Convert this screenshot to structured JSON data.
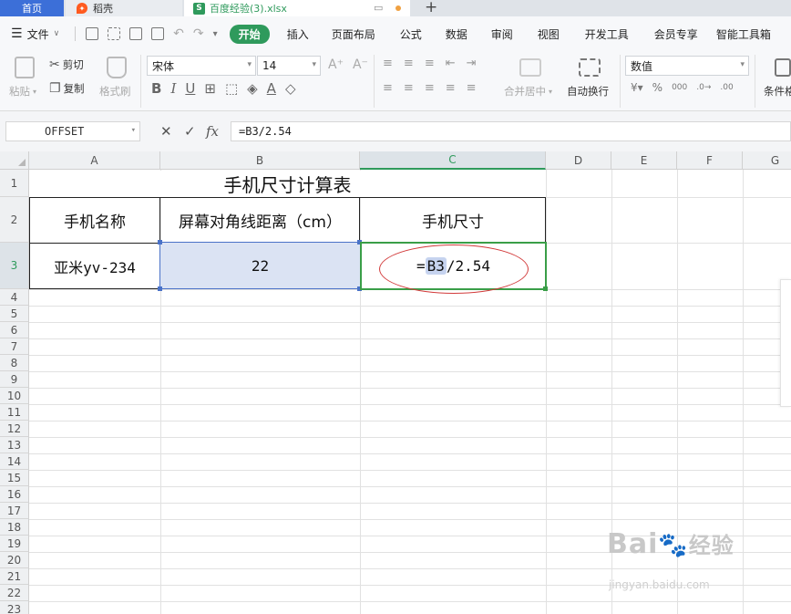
{
  "tabs": {
    "home": "首页",
    "docer": "稻壳",
    "file": "百度经验(3).xlsx"
  },
  "menu": {
    "file": "文件",
    "items": [
      "开始",
      "插入",
      "页面布局",
      "公式",
      "数据",
      "审阅",
      "视图",
      "开发工具",
      "会员专享",
      "智能工具箱"
    ]
  },
  "ribbon": {
    "paste": "粘贴",
    "cut": "剪切",
    "copy": "复制",
    "format_painter": "格式刷",
    "font_name": "宋体",
    "font_size": "14",
    "merge_center": "合并居中",
    "wrap_text": "自动换行",
    "number_format": "数值",
    "conditional_format": "条件格"
  },
  "formula_bar": {
    "name_box": "OFFSET",
    "formula": "=B3/2.54"
  },
  "columns": [
    "A",
    "B",
    "C",
    "D",
    "E",
    "F",
    "G"
  ],
  "rows": [
    "1",
    "2",
    "3",
    "4",
    "5",
    "6",
    "7",
    "8",
    "9",
    "10",
    "11",
    "12",
    "13",
    "14",
    "15",
    "16",
    "17",
    "18",
    "19",
    "20",
    "21",
    "22",
    "23"
  ],
  "sheet": {
    "title": "手机尺寸计算表",
    "header_a": "手机名称",
    "header_b": "屏幕对角线距离（cm）",
    "header_c": "手机尺寸",
    "a3": "亚米yv-234",
    "b3": "22",
    "c3_prefix": "=",
    "c3_ref": "B3",
    "c3_suffix": "/2.54"
  },
  "watermark": {
    "brand": "Bai",
    "brand2": "经验",
    "url": "jingyan.baidu.com"
  },
  "colors": {
    "accent": "#2f9a5c",
    "selection_blue": "#4a72c8",
    "annotation_red": "#d23b3b"
  }
}
